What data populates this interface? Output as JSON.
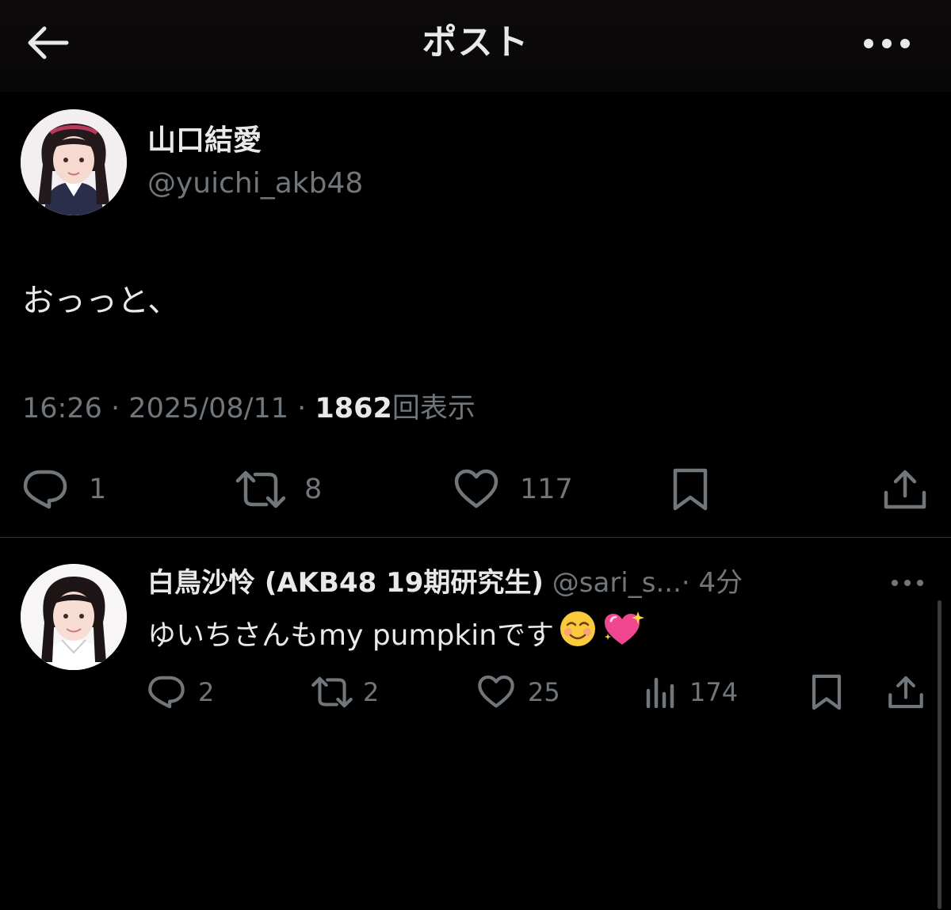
{
  "header": {
    "title": "ポスト",
    "back_icon": "arrow-left-icon",
    "more_icon": "more-horizontal-icon"
  },
  "post": {
    "author_name": "山口結愛",
    "author_handle": "@yuichi_akb48",
    "text": "おっっと、",
    "time": "16:26",
    "separator": "·",
    "date": "2025/08/11",
    "views": "1862",
    "views_label": "回表示",
    "actions": {
      "replies": "1",
      "reposts": "8",
      "likes": "117"
    }
  },
  "reply": {
    "author_name": "白鳥沙怜 (AKB48 19期研究生)",
    "author_handle": "@sari_s...",
    "separator": "·",
    "time": "4分",
    "text": "ゆいちさんもmy pumpkinです",
    "emojis": [
      "smiling-face-icon",
      "sparkling-heart-icon"
    ],
    "actions": {
      "replies": "2",
      "reposts": "2",
      "likes": "25",
      "views": "174"
    }
  },
  "colors": {
    "background": "#000000",
    "primary_text": "#e7e9ea",
    "secondary_text": "#71767b",
    "divider": "#2f3336",
    "heart_pink": "#f0458f"
  }
}
